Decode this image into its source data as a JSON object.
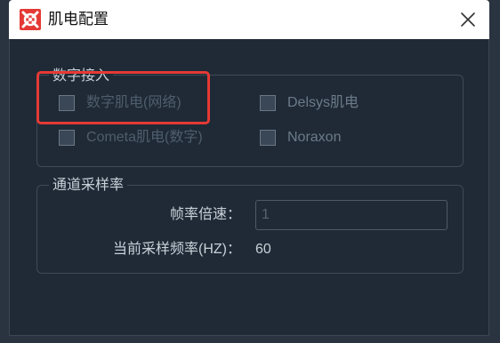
{
  "window": {
    "title": "肌电配置",
    "close_icon": "close-icon",
    "app_icon": "app-logo-icon",
    "accent_color": "#e53935"
  },
  "digital_group": {
    "title": "数字接入",
    "options": [
      {
        "label": "数字肌电(网络)",
        "checked": false,
        "enabled": false
      },
      {
        "label": "Delsys肌电",
        "checked": false,
        "enabled": true
      },
      {
        "label": "Cometa肌电(数字)",
        "checked": false,
        "enabled": false
      },
      {
        "label": "Noraxon",
        "checked": false,
        "enabled": true
      }
    ]
  },
  "sampling_group": {
    "title": "通道采样率",
    "frame_rate_label": "帧率倍速：",
    "frame_rate_value": "1",
    "current_rate_label": "当前采样频率(HZ)：",
    "current_rate_value": "60"
  }
}
